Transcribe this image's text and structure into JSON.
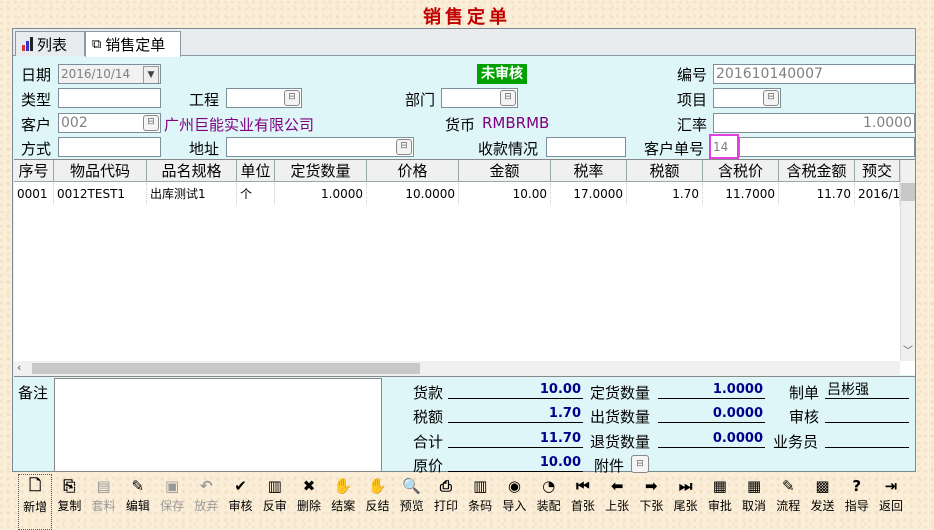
{
  "window": {
    "title": "销售定单"
  },
  "tabs": [
    {
      "label": "列表"
    },
    {
      "label": "销售定单"
    }
  ],
  "form": {
    "date_label": "日期",
    "date_value": "2016/10/14",
    "status": "未审核",
    "number_label": "编号",
    "number_value": "201610140007",
    "type_label": "类型",
    "project_label": "工程",
    "dept_label": "部门",
    "item_label": "项目",
    "customer_label": "客户",
    "customer_code": "002",
    "customer_name": "广州巨能实业有限公司",
    "currency_label": "货币",
    "currency_value": "RMBRMB",
    "rate_label": "汇率",
    "rate_value": "1.0000",
    "method_label": "方式",
    "address_label": "地址",
    "payment_label": "收款情况",
    "cust_order_label": "客户单号",
    "cust_order_value": "14"
  },
  "grid": {
    "headers": [
      "序号",
      "物品代码",
      "品名规格",
      "单位",
      "定货数量",
      "价格",
      "金额",
      "税率",
      "税额",
      "含税价",
      "含税金额",
      "预交"
    ],
    "rows": [
      [
        "0001",
        "0012TEST1",
        "出库测试1",
        "个",
        "1.0000",
        "10.0000",
        "10.00",
        "17.0000",
        "1.70",
        "11.7000",
        "11.70",
        "2016/1"
      ]
    ]
  },
  "summary": {
    "remark_label": "备注",
    "goods_label": "货款",
    "goods_value": "10.00",
    "tax_label": "税额",
    "tax_value": "1.70",
    "total_label": "合计",
    "total_value": "11.70",
    "orig_label": "原价",
    "orig_value": "10.00",
    "order_qty_label": "定货数量",
    "order_qty_value": "1.0000",
    "out_qty_label": "出货数量",
    "out_qty_value": "0.0000",
    "ret_qty_label": "退货数量",
    "ret_qty_value": "0.0000",
    "attach_label": "附件",
    "maker_label": "制单",
    "maker_value": "吕彬强",
    "auditor_label": "审核",
    "sales_label": "业务员"
  },
  "toolbar": [
    {
      "label": "新增",
      "icon": "new-icon",
      "glyph": "🗋"
    },
    {
      "label": "复制",
      "icon": "copy-icon",
      "glyph": "⎘"
    },
    {
      "label": "套料",
      "icon": "material-icon",
      "glyph": "▤",
      "disabled": true
    },
    {
      "label": "编辑",
      "icon": "edit-icon",
      "glyph": "✎"
    },
    {
      "label": "保存",
      "icon": "save-icon",
      "glyph": "▣",
      "disabled": true
    },
    {
      "label": "放弃",
      "icon": "undo-icon",
      "glyph": "↶",
      "disabled": true
    },
    {
      "label": "审核",
      "icon": "audit-icon",
      "glyph": "✔"
    },
    {
      "label": "反审",
      "icon": "unaudit-icon",
      "glyph": "▥"
    },
    {
      "label": "删除",
      "icon": "delete-icon",
      "glyph": "✖"
    },
    {
      "label": "结案",
      "icon": "close-case-icon",
      "glyph": "✋"
    },
    {
      "label": "反结",
      "icon": "reopen-icon",
      "glyph": "✋"
    },
    {
      "label": "预览",
      "icon": "preview-icon",
      "glyph": "🔍"
    },
    {
      "label": "打印",
      "icon": "print-icon",
      "glyph": "⎙"
    },
    {
      "label": "条码",
      "icon": "barcode-icon",
      "glyph": "▥"
    },
    {
      "label": "导入",
      "icon": "import-icon",
      "glyph": "◉"
    },
    {
      "label": "装配",
      "icon": "assemble-icon",
      "glyph": "◔"
    },
    {
      "label": "首张",
      "icon": "first-icon",
      "glyph": "⏮"
    },
    {
      "label": "上张",
      "icon": "prev-icon",
      "glyph": "⬅"
    },
    {
      "label": "下张",
      "icon": "next-icon",
      "glyph": "➡"
    },
    {
      "label": "尾张",
      "icon": "last-icon",
      "glyph": "⏭"
    },
    {
      "label": "审批",
      "icon": "approve-icon",
      "glyph": "▦"
    },
    {
      "label": "取消",
      "icon": "cancel-icon",
      "glyph": "▦"
    },
    {
      "label": "流程",
      "icon": "flow-icon",
      "glyph": "✎"
    },
    {
      "label": "发送",
      "icon": "send-icon",
      "glyph": "▩"
    },
    {
      "label": "指导",
      "icon": "help-icon",
      "glyph": "?"
    },
    {
      "label": "返回",
      "icon": "return-icon",
      "glyph": "⇥"
    }
  ]
}
